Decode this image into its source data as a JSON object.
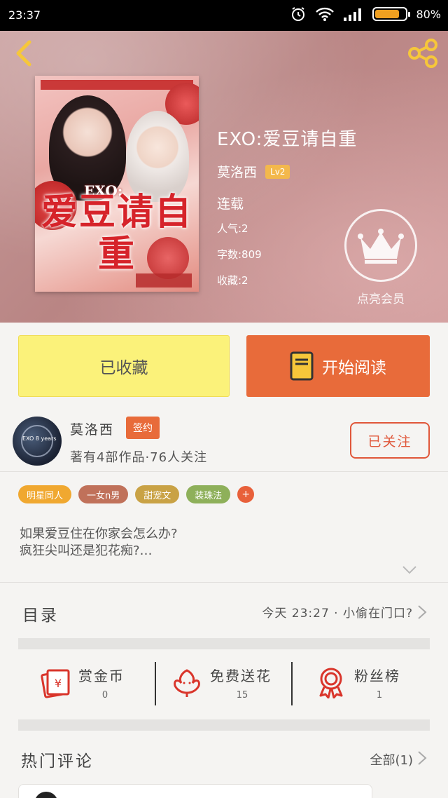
{
  "status_bar": {
    "time": "23:37",
    "battery_text": "80%",
    "battery_level": 0.8
  },
  "book": {
    "title": "EXO:爱豆请自重",
    "author": "莫洛西",
    "level": "Lv2",
    "status": "连载",
    "popularity": "人气:2",
    "word_count": "字数:809",
    "favorites": "收藏:2",
    "cover_art_title": "爱豆请自重",
    "cover_art_sub": "EXO:"
  },
  "vip": {
    "label": "点亮会员"
  },
  "actions": {
    "collected_label": "已收藏",
    "read_label": "开始阅读"
  },
  "author_card": {
    "name": "莫洛西",
    "badge": "签约",
    "stats": "著有4部作品·76人关注",
    "follow_label": "已关注",
    "avatar_text": "EXO 8 years"
  },
  "tags": [
    {
      "label": "明星同人",
      "color": "#f0a830"
    },
    {
      "label": "一女n男",
      "color": "#c0715a"
    },
    {
      "label": "甜宠文",
      "color": "#c9a245"
    },
    {
      "label": "装珠法",
      "color": "#8eb05a"
    }
  ],
  "tag_more": "+",
  "summary": {
    "line1": "如果爱豆住在你家会怎么办?",
    "line2": "疯狂尖叫还是犯花痴?…"
  },
  "catalog": {
    "label": "目录",
    "latest": "今天 23:27 · 小偷在门口?"
  },
  "gifts": [
    {
      "label": "赏金币",
      "value": "0",
      "icon": "reward-coin-icon"
    },
    {
      "label": "免费送花",
      "value": "15",
      "icon": "flower-icon"
    },
    {
      "label": "粉丝榜",
      "value": "1",
      "icon": "fan-ranking-icon"
    }
  ],
  "hot_comments": {
    "label": "热门评论",
    "all_label": "全部(1)"
  },
  "colors": {
    "accent": "#e86b3a",
    "yellow": "#fbf27a"
  }
}
